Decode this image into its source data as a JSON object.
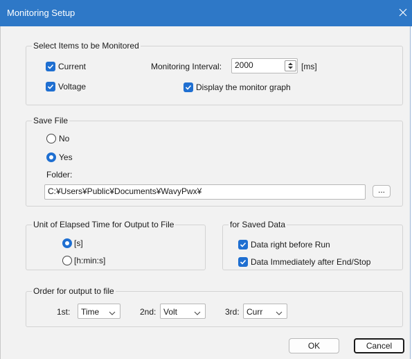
{
  "window": {
    "title": "Monitoring Setup"
  },
  "monitor_group": {
    "legend": "Select Items to be Monitored",
    "current_label": "Current",
    "current_checked": true,
    "voltage_label": "Voltage",
    "voltage_checked": true,
    "interval_label": "Monitoring Interval:",
    "interval_value": "2000",
    "interval_unit": "[ms]",
    "graph_label": "Display the monitor graph",
    "graph_checked": true
  },
  "save_group": {
    "legend": "Save File",
    "no_label": "No",
    "yes_label": "Yes",
    "selected": "Yes",
    "folder_label": "Folder:",
    "folder_value": "C:¥Users¥Public¥Documents¥WavyPwx¥",
    "browse_label": "..."
  },
  "elapsed_group": {
    "legend": "Unit of Elapsed Time for Output to File",
    "option_s": "[s]",
    "option_hms": "[h:min:s]",
    "selected": "[s]"
  },
  "saved_data_group": {
    "legend": "for Saved Data",
    "before_run_label": "Data right before Run",
    "before_run_checked": true,
    "after_end_label": "Data Immediately after End/Stop",
    "after_end_checked": true
  },
  "order_group": {
    "legend": "Order for output to file",
    "first_label": "1st:",
    "first_value": "Time",
    "second_label": "2nd:",
    "second_value": "Volt",
    "third_label": "3rd:",
    "third_value": "Curr"
  },
  "buttons": {
    "ok": "OK",
    "cancel": "Cancel"
  },
  "colors": {
    "titlebar": "#2e78c7",
    "accent": "#1f6fd1",
    "background": "#f2f2f2"
  }
}
